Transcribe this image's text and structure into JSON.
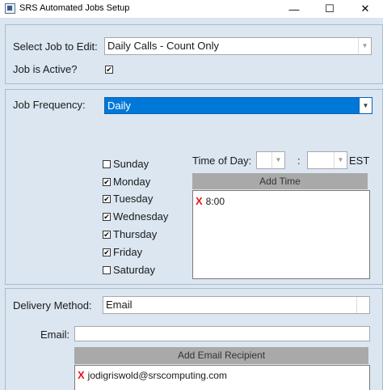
{
  "window": {
    "title": "SRS Automated Jobs Setup",
    "minimize": "—",
    "maximize": "☐",
    "close": "✕"
  },
  "job_section": {
    "select_label": "Select Job to Edit:",
    "select_value": "Daily Calls - Count Only",
    "active_label": "Job is Active?",
    "active_checked": true
  },
  "frequency_section": {
    "label": "Job Frequency:",
    "value": "Daily",
    "days": [
      {
        "label": "Sunday",
        "checked": false
      },
      {
        "label": "Monday",
        "checked": true
      },
      {
        "label": "Tuesday",
        "checked": true
      },
      {
        "label": "Wednesday",
        "checked": true
      },
      {
        "label": "Thursday",
        "checked": true
      },
      {
        "label": "Friday",
        "checked": true
      },
      {
        "label": "Saturday",
        "checked": false
      }
    ],
    "time_label": "Time of Day:",
    "hour_value": "",
    "separator": ":",
    "minute_value": "",
    "timezone": "EST",
    "add_time_button": "Add Time",
    "times": [
      "8:00"
    ]
  },
  "delivery_section": {
    "method_label": "Delivery Method:",
    "method_value": "Email",
    "email_label": "Email:",
    "email_value": "",
    "add_recipient_button": "Add Email Recipient",
    "recipients": [
      "jodigriswold@srscomputing.com"
    ]
  },
  "colors": {
    "background": "#dbe6f1",
    "selection": "#0078d7",
    "remove_x": "#e8141b",
    "button_grey": "#a9a9a9"
  },
  "icons": {
    "remove": "X",
    "dropdown": "▼",
    "check": "✔"
  }
}
